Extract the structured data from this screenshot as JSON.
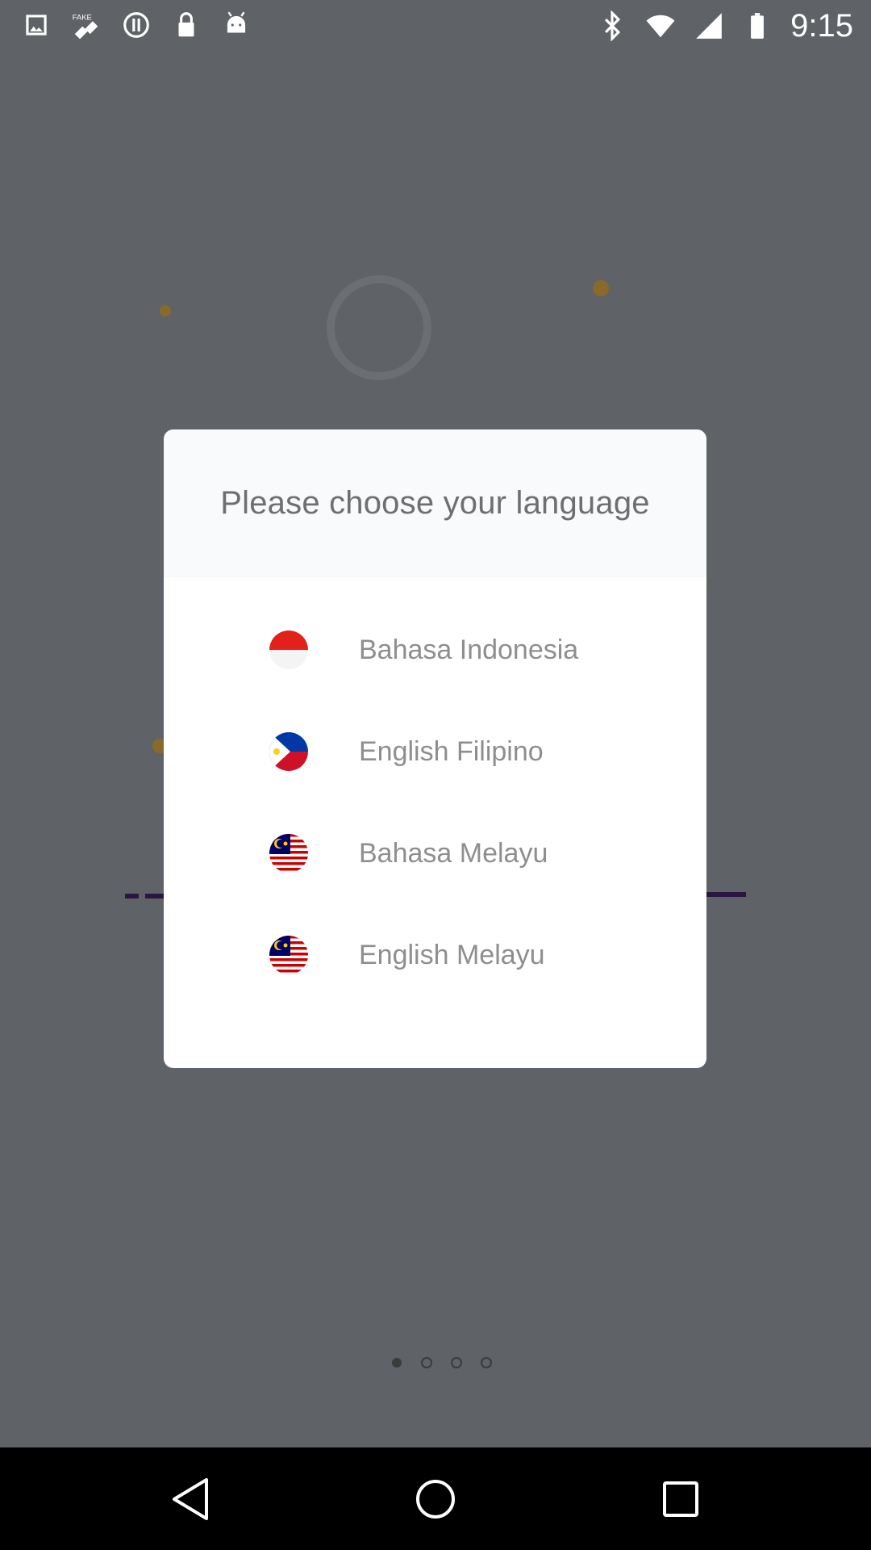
{
  "status_bar": {
    "time": "9:15",
    "left_icons": [
      "image-icon",
      "fake-gps-icon",
      "alert-circle-icon",
      "lock-icon",
      "android-icon"
    ],
    "right_icons": [
      "bluetooth-icon",
      "wifi-icon",
      "signal-icon",
      "battery-icon"
    ]
  },
  "dialog": {
    "title": "Please choose your language",
    "options": [
      {
        "label": "Bahasa Indonesia",
        "flag": "indonesia-flag-icon"
      },
      {
        "label": "English Filipino",
        "flag": "philippines-flag-icon"
      },
      {
        "label": "Bahasa Melayu",
        "flag": "malaysia-flag-icon"
      },
      {
        "label": "English Melayu",
        "flag": "malaysia-flag-icon"
      }
    ]
  },
  "pager": {
    "count": 4,
    "active": 0
  },
  "nav_bar": {
    "buttons": [
      "back-icon",
      "home-icon",
      "recents-icon"
    ]
  },
  "colors": {
    "scrim": "#5f6266",
    "dialog_bg": "#ffffff",
    "header_bg": "#f9fafb",
    "text_muted": "#8e8e8e",
    "indonesia_red": "#e32118",
    "philippines_blue": "#0038a8",
    "philippines_red": "#ce1126",
    "malaysia_blue": "#010066",
    "accent_dot": "#8a6a2a"
  }
}
